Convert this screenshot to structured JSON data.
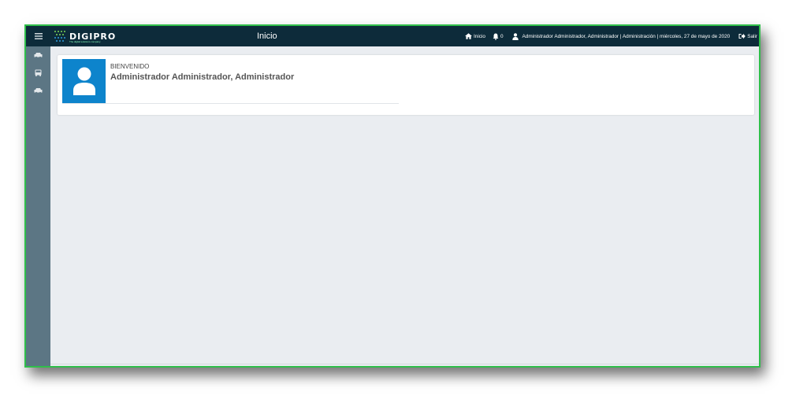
{
  "app": {
    "logo_text": "DIGIPRO",
    "logo_tagline": "The digital solutions company"
  },
  "header": {
    "page_title": "Inicio",
    "home_label": "Inicio",
    "notifications_count": "0",
    "user_info": "Administrador Administrador, Administrador | Administración | miércoles, 27 de mayo de 2020",
    "logout_label": "Salir"
  },
  "sidebar": {
    "items": [
      {
        "icon": "car-icon"
      },
      {
        "icon": "bus-icon"
      },
      {
        "icon": "car-icon"
      }
    ]
  },
  "welcome": {
    "label": "BIENVENIDO",
    "name": "Administrador Administrador, Administrador"
  },
  "colors": {
    "topbar": "#0d2b3a",
    "sidebar": "#5c7684",
    "avatar_bg": "#0d84cc",
    "window_border": "#2fbe4a"
  }
}
